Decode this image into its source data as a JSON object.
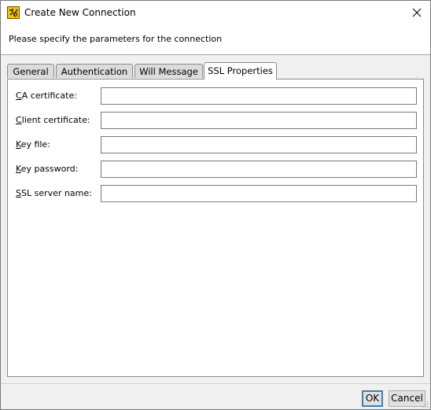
{
  "window": {
    "title": "Create New Connection",
    "subtitle": "Please specify the parameters for the connection"
  },
  "tabs": [
    {
      "label": "General",
      "active": false
    },
    {
      "label": "Authentication",
      "active": false
    },
    {
      "label": "Will Message",
      "active": false
    },
    {
      "label": "SSL Properties",
      "active": true
    }
  ],
  "ssl": {
    "fields": [
      {
        "accel": "C",
        "rest": "A certificate:",
        "value": ""
      },
      {
        "accel": "C",
        "rest": "lient certificate:",
        "value": ""
      },
      {
        "accel": "K",
        "rest": "ey file:",
        "value": ""
      },
      {
        "accel": "K",
        "rest": "ey password:",
        "value": ""
      },
      {
        "accel": "S",
        "rest": "SL server name:",
        "value": ""
      }
    ]
  },
  "buttons": {
    "ok": "OK",
    "cancel": "Cancel"
  },
  "icons": {
    "app": "app-plug-icon",
    "close": "close-icon",
    "resize": "resize-grip-icon"
  }
}
